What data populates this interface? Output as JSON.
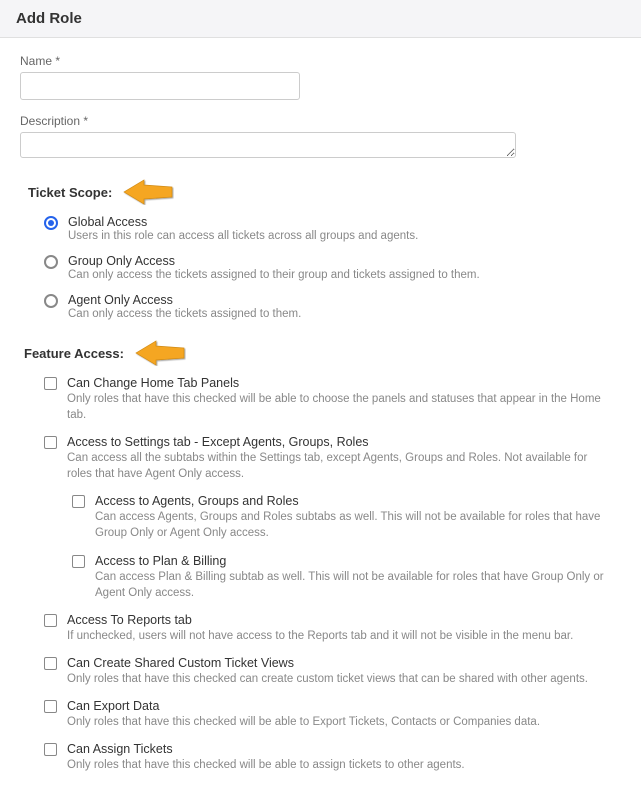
{
  "header": {
    "title": "Add Role"
  },
  "form": {
    "name_label": "Name *",
    "name_value": "",
    "description_label": "Description *",
    "description_value": ""
  },
  "ticket_scope": {
    "title": "Ticket Scope:",
    "selected": "global",
    "options": [
      {
        "key": "global",
        "label": "Global Access",
        "hint": "Users in this role can access all tickets across all groups and agents."
      },
      {
        "key": "group",
        "label": "Group Only Access",
        "hint": "Can only access the tickets assigned to their group and tickets assigned to them."
      },
      {
        "key": "agent",
        "label": "Agent Only Access",
        "hint": "Can only access the tickets assigned to them."
      }
    ]
  },
  "feature_access": {
    "title": "Feature Access:",
    "items": [
      {
        "label": "Can Change Home Tab Panels",
        "hint": "Only roles that have this checked will be able to choose the panels and statuses that appear in the Home tab.",
        "nested": false
      },
      {
        "label": "Access to Settings tab - Except Agents, Groups, Roles",
        "hint": "Can access all the subtabs within the Settings tab, except Agents, Groups and Roles. Not available for roles that have Agent Only access.",
        "nested": false
      },
      {
        "label": "Access to Agents, Groups and Roles",
        "hint": "Can access Agents, Groups and Roles subtabs as well. This will not be available for roles that have Group Only or Agent Only access.",
        "nested": true
      },
      {
        "label": "Access to Plan & Billing",
        "hint": "Can access Plan & Billing subtab as well. This will not be available for roles that have Group Only or Agent Only access.",
        "nested": true
      },
      {
        "label": "Access To Reports tab",
        "hint": "If unchecked, users will not have access to the Reports tab and it will not be visible in the menu bar.",
        "nested": false
      },
      {
        "label": "Can Create Shared Custom Ticket Views",
        "hint": "Only roles that have this checked can create custom ticket views that can be shared with other agents.",
        "nested": false
      },
      {
        "label": "Can Export Data",
        "hint": "Only roles that have this checked will be able to Export Tickets, Contacts or Companies data.",
        "nested": false
      },
      {
        "label": "Can Assign Tickets",
        "hint": "Only roles that have this checked will be able to assign tickets to other agents.",
        "nested": false
      }
    ]
  },
  "annotations": {
    "arrow_color": "#f5a623"
  }
}
